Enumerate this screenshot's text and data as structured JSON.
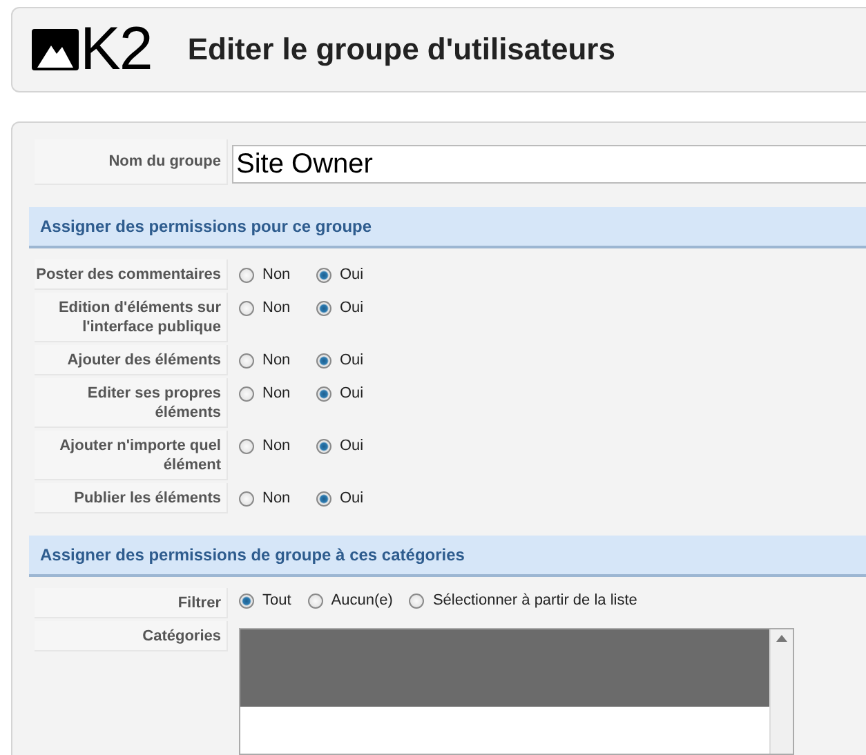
{
  "header": {
    "logo_text": "K2",
    "title": "Editer le groupe d'utilisateurs"
  },
  "group_name": {
    "label": "Nom du groupe",
    "value": "Site Owner"
  },
  "permissions": {
    "title": "Assigner des permissions pour ce groupe",
    "rows": [
      {
        "label": "Poster des commentaires",
        "options": [
          {
            "label": "Non",
            "selected": false
          },
          {
            "label": "Oui",
            "selected": true
          }
        ]
      },
      {
        "label": "Edition d'éléments sur l'interface publique",
        "options": [
          {
            "label": "Non",
            "selected": false
          },
          {
            "label": "Oui",
            "selected": true
          }
        ]
      },
      {
        "label": "Ajouter des éléments",
        "options": [
          {
            "label": "Non",
            "selected": false
          },
          {
            "label": "Oui",
            "selected": true
          }
        ]
      },
      {
        "label": "Editer ses propres éléments",
        "options": [
          {
            "label": "Non",
            "selected": false
          },
          {
            "label": "Oui",
            "selected": true
          }
        ]
      },
      {
        "label": "Ajouter n'importe quel élément",
        "options": [
          {
            "label": "Non",
            "selected": false
          },
          {
            "label": "Oui",
            "selected": true
          }
        ]
      },
      {
        "label": "Publier les éléments",
        "options": [
          {
            "label": "Non",
            "selected": false
          },
          {
            "label": "Oui",
            "selected": true
          }
        ]
      }
    ]
  },
  "categories_section": {
    "title": "Assigner des permissions de groupe à ces catégories",
    "filter": {
      "label": "Filtrer",
      "options": [
        {
          "label": "Tout",
          "selected": true
        },
        {
          "label": "Aucun(e)",
          "selected": false
        },
        {
          "label": "Sélectionner à partir de la liste",
          "selected": false
        }
      ]
    },
    "categories": {
      "label": "Catégories",
      "items": [
        {
          "selected": true
        }
      ]
    }
  }
}
